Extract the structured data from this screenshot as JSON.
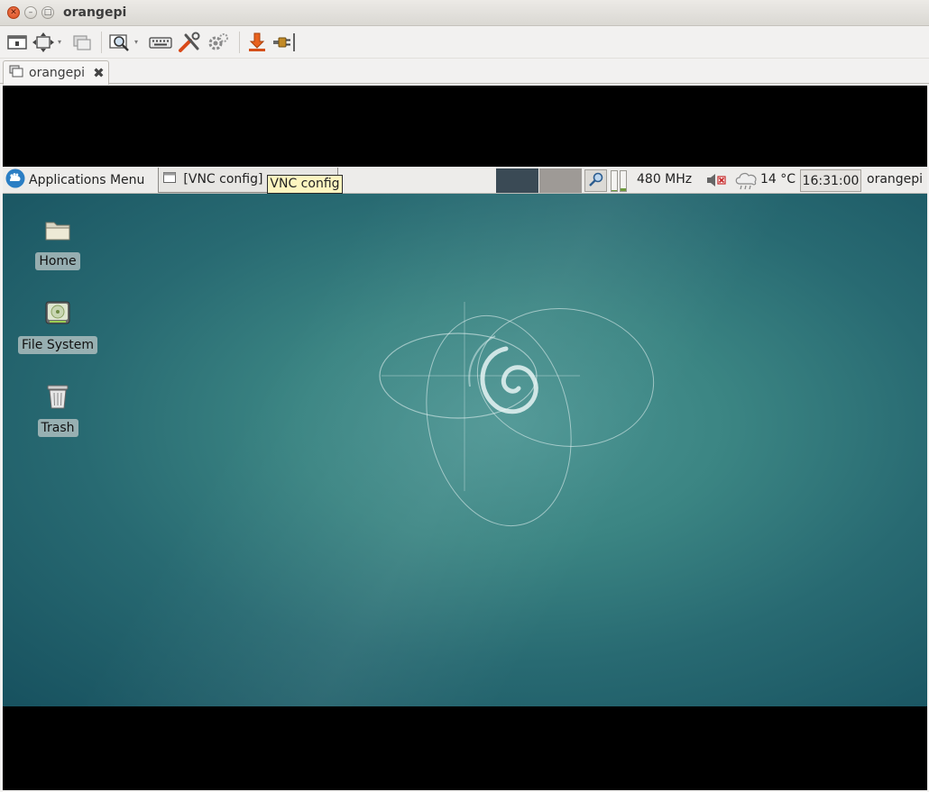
{
  "window": {
    "title": "orangepi",
    "close_glyph": "✕",
    "minimize_glyph": "–",
    "maximize_glyph": "□"
  },
  "toolbar": {
    "icons": [
      "window-icon",
      "fullscreen-icon",
      "multi-window-icon",
      "zoom-icon",
      "keyboard-icon",
      "preferences-icon",
      "settings-icon",
      "screenshot-icon",
      "disconnect-icon"
    ],
    "dropdown_glyph": "▾"
  },
  "tab": {
    "label": "orangepi",
    "close_glyph": "✖"
  },
  "remote": {
    "panel": {
      "apps_menu_label": "Applications Menu",
      "task_label": "[VNC config]",
      "tooltip": "VNC config",
      "cpu_freq": "480 MHz",
      "temperature": "14 °C",
      "clock": "16:31:00",
      "username": "orangepi",
      "cpu_load_fractions": [
        0.05,
        0.15
      ]
    },
    "desktop": {
      "icons": [
        {
          "label": "Home",
          "icon": "folder-icon"
        },
        {
          "label": "File System",
          "icon": "drive-icon"
        },
        {
          "label": "Trash",
          "icon": "trash-icon"
        }
      ]
    }
  },
  "colors": {
    "desktop_teal": "#3b8583",
    "workspace_active": "#3a4a55",
    "workspace_inactive": "#9e9a96",
    "tooltip_bg": "#fdf5c0"
  }
}
